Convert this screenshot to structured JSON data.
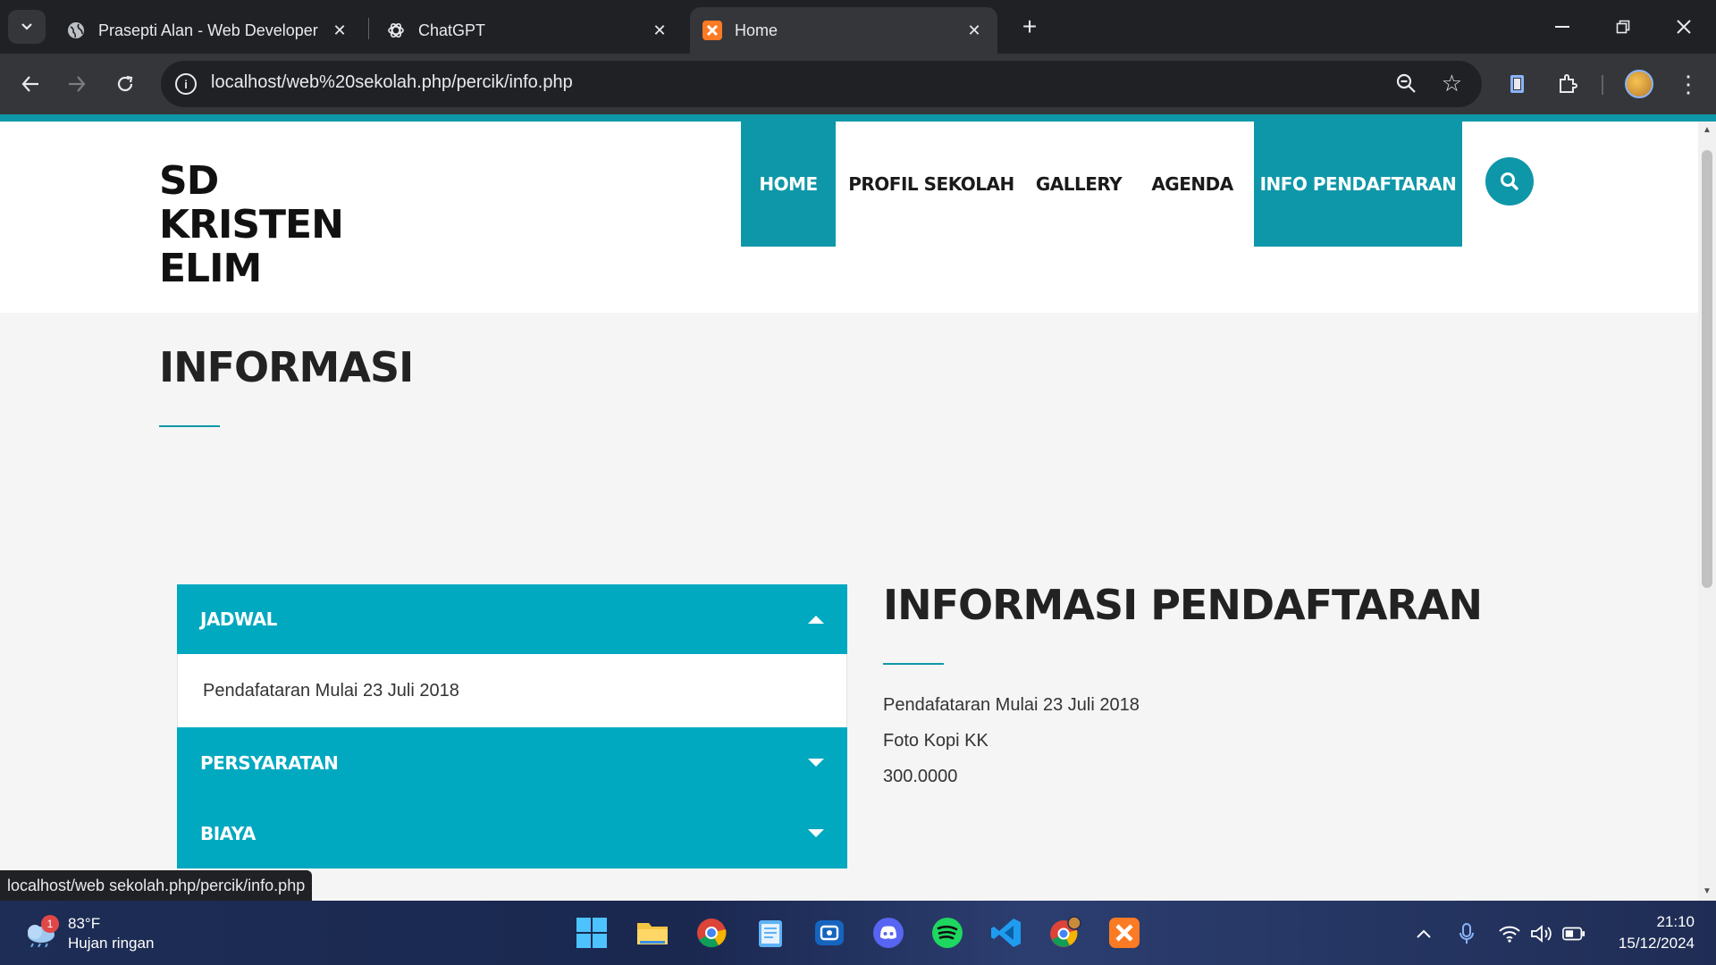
{
  "browser": {
    "tabs": [
      {
        "title": "Prasepti Alan - Web Developer",
        "icon": "globe-icon"
      },
      {
        "title": "ChatGPT",
        "icon": "chatgpt-icon"
      },
      {
        "title": "Home",
        "icon": "xampp-icon",
        "active": true
      }
    ],
    "url": "localhost/web%20sekolah.php/percik/info.php",
    "status_url": "localhost/web sekolah.php/percik/info.php"
  },
  "site": {
    "logo_lines": [
      "SD",
      "KRISTEN",
      "ELIM"
    ],
    "nav": [
      {
        "label": "HOME",
        "active": true
      },
      {
        "label": "PROFIL SEKOLAH",
        "active": false
      },
      {
        "label": "GALLERY",
        "active": false
      },
      {
        "label": "AGENDA",
        "active": false
      },
      {
        "label": "INFO PENDAFTARAN",
        "active": true
      }
    ],
    "page_title": "INFORMASI",
    "accordion": [
      {
        "title": "JADWAL",
        "expanded": true,
        "content": "Pendafataran Mulai 23 Juli 2018"
      },
      {
        "title": "PERSYARATAN",
        "expanded": false
      },
      {
        "title": "BIAYA",
        "expanded": false
      }
    ],
    "info": {
      "title": "INFORMASI PENDAFTARAN",
      "lines": [
        "Pendafataran Mulai 23 Juli 2018",
        "Foto Kopi KK",
        "300.0000"
      ]
    },
    "accent_color": "#0e97a8"
  },
  "taskbar": {
    "weather": {
      "temp": "83°F",
      "condition": "Hujan ringan",
      "badge": "1"
    },
    "apps": [
      "windows-start-icon",
      "file-explorer-icon",
      "chrome-icon",
      "notepad-icon",
      "screen-capture-icon",
      "discord-icon",
      "spotify-icon",
      "vscode-icon",
      "chrome-profile-icon",
      "xampp-icon"
    ],
    "time": "21:10",
    "date": "15/12/2024"
  }
}
